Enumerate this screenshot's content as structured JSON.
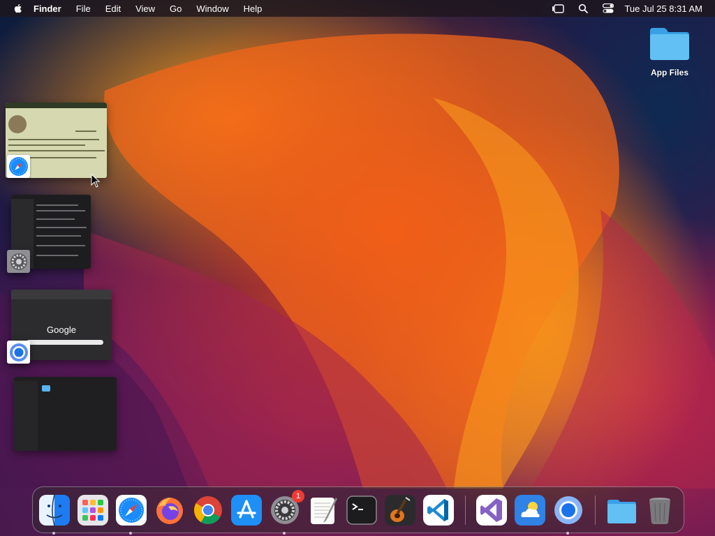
{
  "menubar": {
    "app_name": "Finder",
    "items": [
      "File",
      "Edit",
      "View",
      "Go",
      "Window",
      "Help"
    ],
    "clock": "Tue Jul 25  8:31 AM"
  },
  "desktop": {
    "folder_label": "App Files"
  },
  "thumbnails": {
    "chrome_google_text": "Google"
  },
  "dock": {
    "items": [
      {
        "name": "finder-icon",
        "running": true
      },
      {
        "name": "launchpad-icon",
        "running": false
      },
      {
        "name": "safari-icon",
        "running": true
      },
      {
        "name": "firefox-icon",
        "running": false
      },
      {
        "name": "chrome-icon",
        "running": false
      },
      {
        "name": "app-store-icon",
        "running": false
      },
      {
        "name": "system-settings-icon",
        "running": true
      },
      {
        "name": "textedit-icon",
        "running": false
      },
      {
        "name": "terminal-icon",
        "running": false
      },
      {
        "name": "garageband-icon",
        "running": false
      },
      {
        "name": "vscode-icon",
        "running": false
      },
      {
        "name": "visual-studio-icon",
        "running": false
      },
      {
        "name": "weather-icon",
        "running": false
      },
      {
        "name": "chromium-icon",
        "running": true
      },
      {
        "name": "folder-icon",
        "running": false
      },
      {
        "name": "trash-icon",
        "running": false
      }
    ],
    "settings_badge": "1"
  },
  "colors": {
    "accent_blue": "#1a8cff",
    "badge_red": "#ef3b34"
  }
}
